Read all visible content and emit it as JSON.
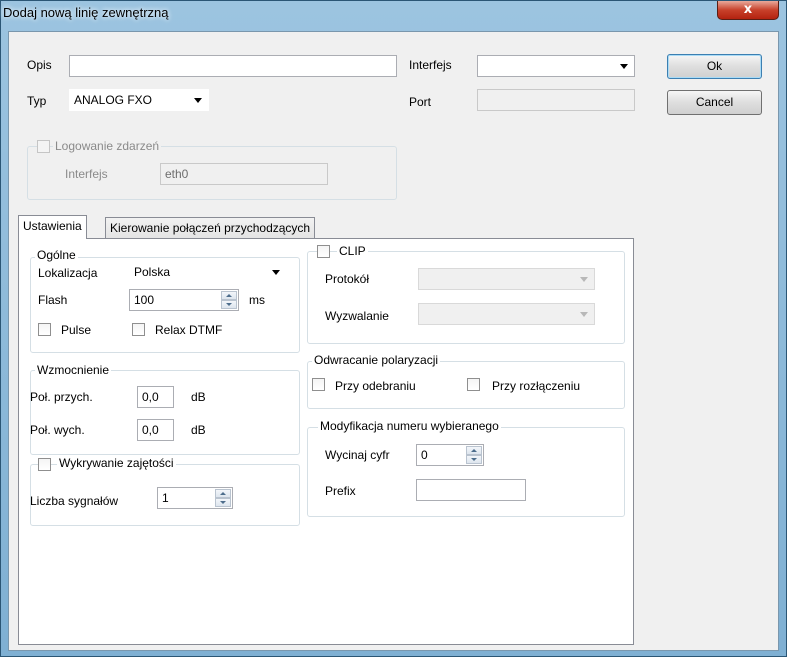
{
  "window": {
    "title": "Dodaj nową linię zewnętrzną",
    "close_label": "x"
  },
  "form": {
    "opis_label": "Opis",
    "opis_value": "",
    "typ_label": "Typ",
    "typ_value": "ANALOG FXO",
    "interfejs_label": "Interfejs",
    "interfejs_value": "",
    "port_label": "Port",
    "port_value": ""
  },
  "buttons": {
    "ok": "Ok",
    "cancel": "Cancel"
  },
  "logging": {
    "label": "Logowanie zdarzeń",
    "checked": false,
    "interfejs_label": "Interfejs",
    "interfejs_value": "eth0"
  },
  "tabs": [
    {
      "label": "Ustawienia",
      "active": true
    },
    {
      "label": "Kierowanie połączeń przychodzących",
      "active": false
    }
  ],
  "ogolne": {
    "title": "Ogólne",
    "lokalizacja_label": "Lokalizacja",
    "lokalizacja_value": "Polska",
    "flash_label": "Flash",
    "flash_value": "100",
    "flash_unit": "ms",
    "pulse_label": "Pulse",
    "relax_label": "Relax DTMF"
  },
  "wzmocnienie": {
    "title": "Wzmocnienie",
    "przych_label": "Poł. przych.",
    "przych_value": "0,0",
    "przych_unit": "dB",
    "wych_label": "Poł. wych.",
    "wych_value": "0,0",
    "wych_unit": "dB"
  },
  "wykrywanie": {
    "title": "Wykrywanie zajętości",
    "sygnalow_label": "Liczba sygnałów",
    "sygnalow_value": "1"
  },
  "clip": {
    "title": "CLIP",
    "protokol_label": "Protokół",
    "protokol_value": "",
    "wyzwalanie_label": "Wyzwalanie",
    "wyzwalanie_value": ""
  },
  "polaryzacja": {
    "title": "Odwracanie polaryzacji",
    "odebraniu_label": "Przy odebraniu",
    "rozlaczeniu_label": "Przy rozłączeniu"
  },
  "modyfikacja": {
    "title": "Modyfikacja numeru wybieranego",
    "wycinaj_label": "Wycinaj cyfr",
    "wycinaj_value": "0",
    "prefix_label": "Prefix",
    "prefix_value": ""
  }
}
